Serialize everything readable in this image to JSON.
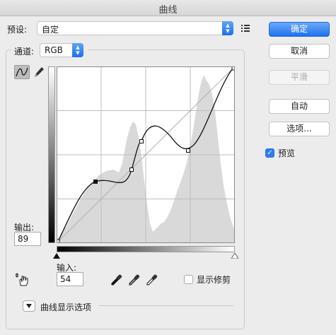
{
  "window": {
    "title": "曲线"
  },
  "preset": {
    "label": "预设:",
    "value": "自定"
  },
  "channel": {
    "label": "通道:",
    "value": "RGB"
  },
  "output": {
    "label": "输出:",
    "value": "89"
  },
  "input": {
    "label": "输入:",
    "value": "54"
  },
  "show_clipping": {
    "label": "显示修剪",
    "checked": false
  },
  "curve_display_options": {
    "label": "曲线显示选项"
  },
  "buttons": {
    "ok": "确定",
    "cancel": "取消",
    "smooth": "平滑",
    "auto": "自动",
    "options": "选项..."
  },
  "preview": {
    "label": "预览",
    "checked": true
  },
  "colors": {
    "accent": "#1f71f0",
    "histogram": "#d9d9d9"
  },
  "icons": [
    "chevron-updown-icon",
    "preset-menu-icon",
    "curve-tool-icon",
    "pencil-icon",
    "hand-adjust-icon",
    "black-eyedropper-icon",
    "gray-eyedropper-icon",
    "white-eyedropper-icon",
    "disclosure-triangle-icon"
  ]
}
